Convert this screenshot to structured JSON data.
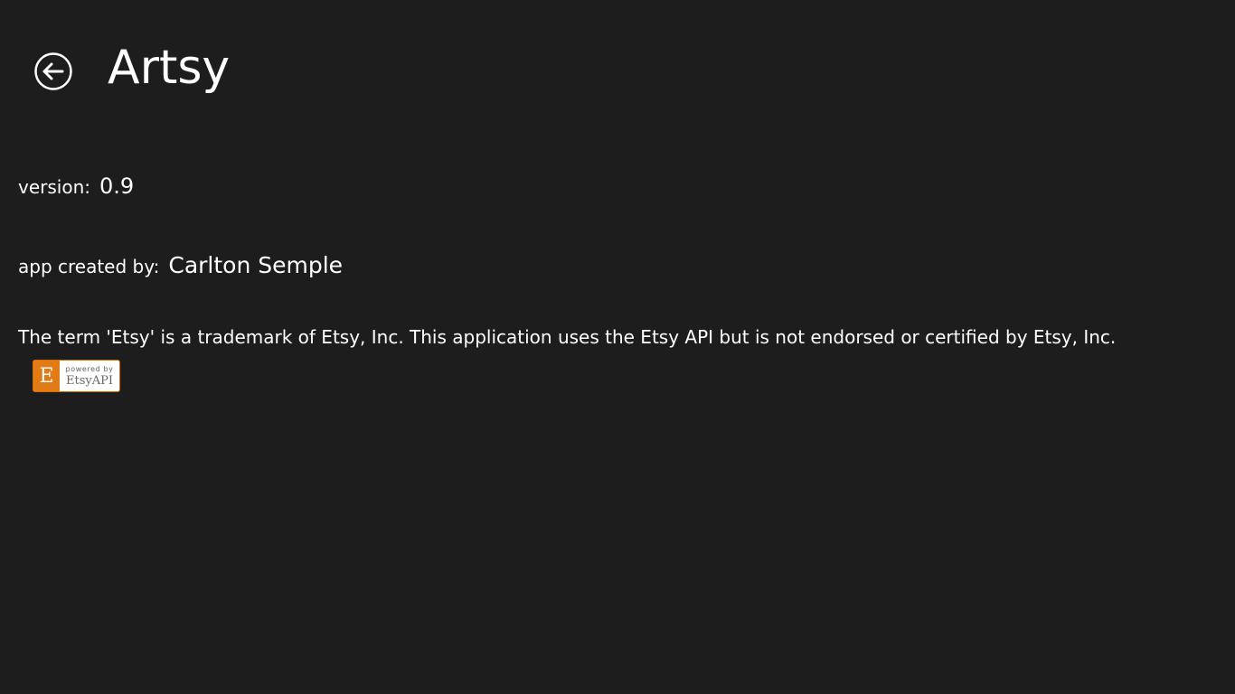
{
  "header": {
    "back_icon": "back-arrow-circle-icon",
    "title": "Artsy"
  },
  "about": {
    "version_label": "version:",
    "version_value": "0.9",
    "author_label": "app created by:",
    "author_value": "Carlton Semple",
    "disclaimer": "The term 'Etsy' is a trademark of Etsy, Inc. This application uses the Etsy API but is not endorsed or certified by Etsy, Inc."
  },
  "badge": {
    "letter": "E",
    "small_text": "powered by",
    "big_text": "EtsyAPI"
  },
  "colors": {
    "background": "#1d1d1d",
    "text": "#ffffff",
    "badge_orange": "#e07b16"
  }
}
